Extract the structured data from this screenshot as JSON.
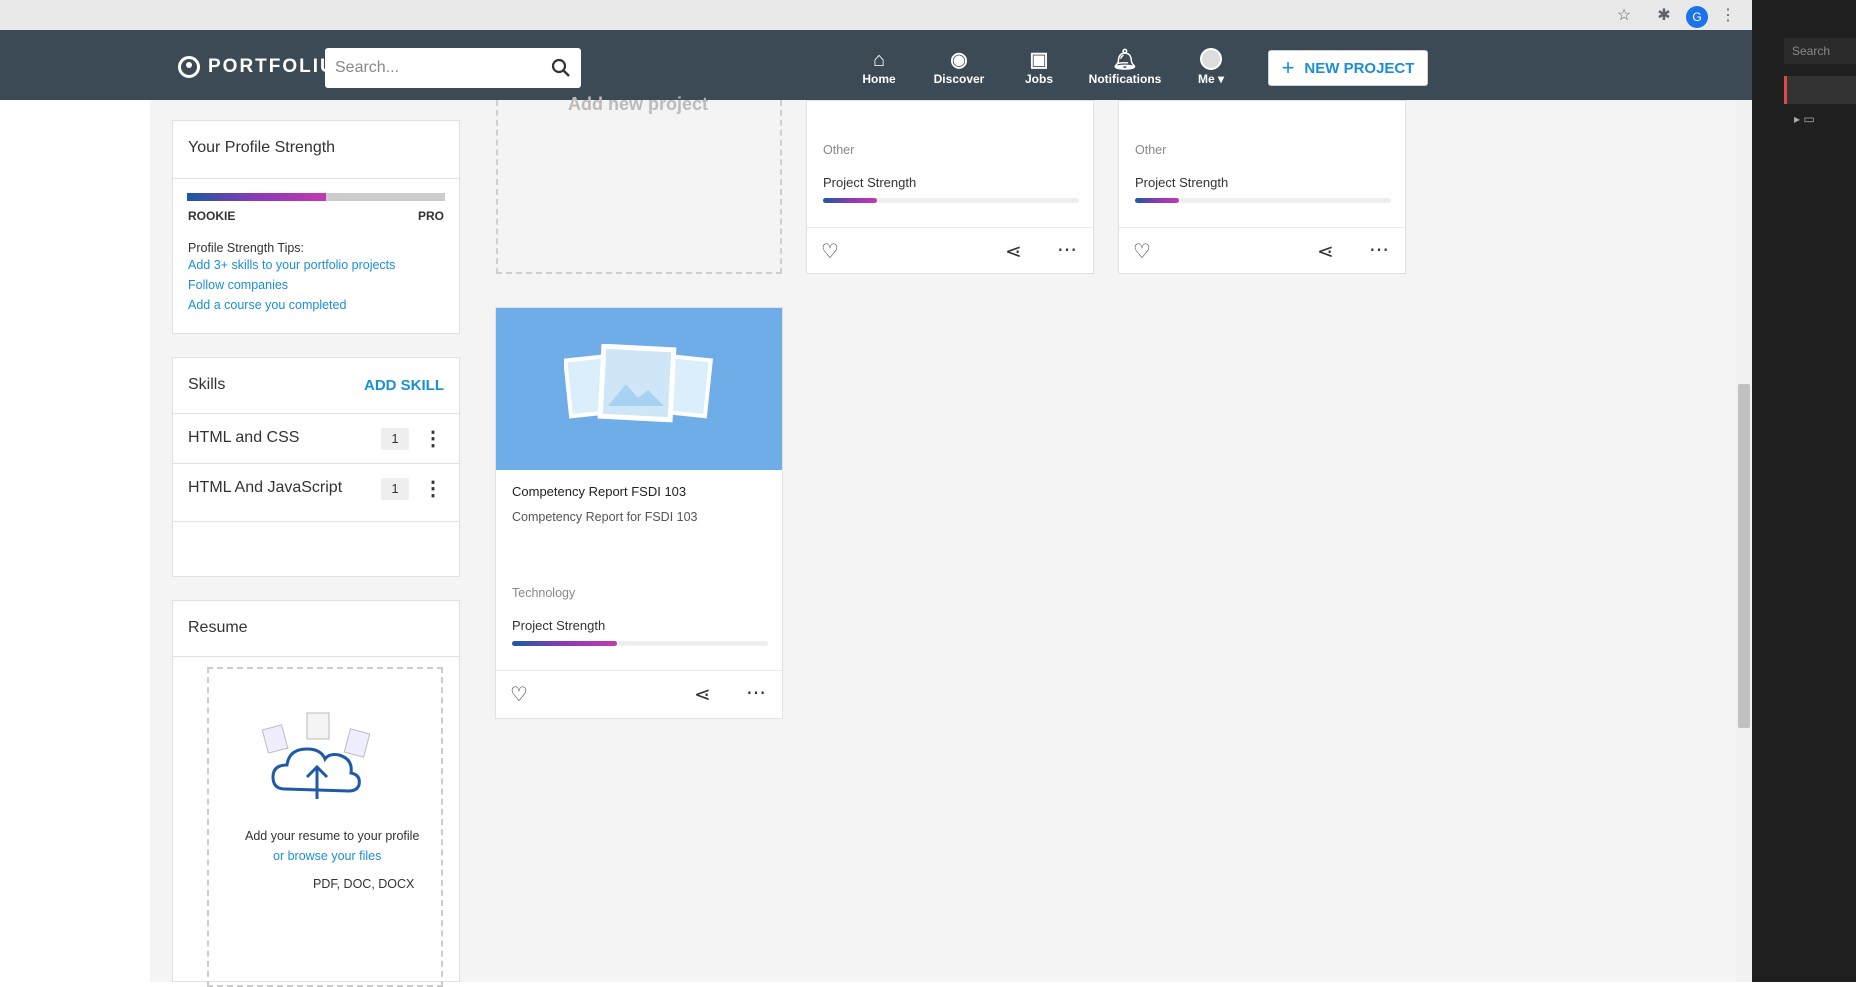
{
  "browser": {
    "profile_initial": "G"
  },
  "header": {
    "logo_text": "PORTFOLIUM",
    "search_placeholder": "Search...",
    "nav": [
      {
        "label": "Home"
      },
      {
        "label": "Discover"
      },
      {
        "label": "Jobs"
      },
      {
        "label": "Notifications"
      },
      {
        "label": "Me"
      }
    ],
    "new_project": "NEW PROJECT"
  },
  "profile_strength": {
    "title": "Your Profile Strength",
    "min_label": "ROOKIE",
    "max_label": "PRO",
    "level": 0.54,
    "tips_label": "Profile Strength Tips:",
    "tips": [
      "Add 3+ skills to your portfolio projects",
      "Follow companies",
      "Add a course you completed"
    ]
  },
  "skills": {
    "title": "Skills",
    "add_label": "ADD SKILL",
    "items": [
      {
        "name": "HTML and CSS",
        "count": "1"
      },
      {
        "name": "HTML And JavaScript",
        "count": "1"
      }
    ]
  },
  "resume": {
    "title": "Resume",
    "line1": "Add your resume to your profile",
    "line2": "or browse your files",
    "formats": "PDF, DOC, DOCX"
  },
  "projects": {
    "add_new_label": "Add new project",
    "items": [
      {
        "category": "Other",
        "strength_label": "Project Strength",
        "strength": 0.21
      },
      {
        "category": "Other",
        "strength_label": "Project Strength",
        "strength": 0.17
      },
      {
        "title": "Competency Report FSDI 103",
        "description": "Competency Report for FSDI 103",
        "category": "Technology",
        "strength_label": "Project Strength",
        "strength": 0.41
      }
    ]
  },
  "devtools": {
    "search_placeholder": "Search"
  }
}
